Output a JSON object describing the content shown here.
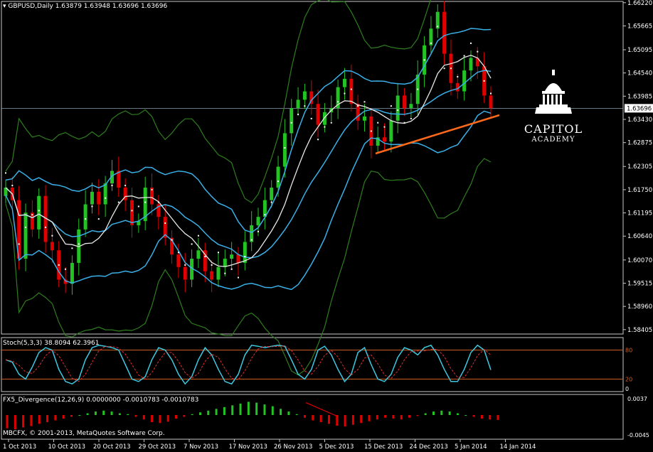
{
  "header": {
    "symbol": "GBPUSD,Daily",
    "ohlc": "1.63879 1.63948 1.63696 1.63696"
  },
  "price_label": "1.63696",
  "logo": {
    "line1": "CAPITOL",
    "line2": "ACADEMY"
  },
  "stoch": {
    "label": "Stoch(5,3,3) 38.8094 62.3961",
    "levels": [
      "80",
      "20"
    ]
  },
  "fx5": {
    "label": "FX5_Divergence(12,26,9) 0.0000000 -0.0010783 -0.0010783",
    "ticks": [
      "0.0037",
      "-0.0045"
    ]
  },
  "copyright": "MBCFX, © 2001-2013, MetaQuotes Software Corp.",
  "colors": {
    "bull": "#22c322",
    "bear": "#e00000",
    "band_outer": "#2e7d1e",
    "band_inner": "#3ab0e8",
    "ma": "#e8e8e8",
    "ma_down": "#ff6a4d",
    "trend": "#ff6a1a",
    "sar": "#ffffff",
    "stoch_main": "#3ec8e0",
    "stoch_signal": "#e03030",
    "level": "#d06020"
  },
  "chart_data": [
    {
      "type": "candlestick",
      "title": "GBPUSD,Daily",
      "ylim": [
        1.582,
        1.625
      ],
      "y_ticks": [
        "1.66220",
        "1.65665",
        "1.65095",
        "1.64540",
        "1.63985",
        "1.63430",
        "1.62875",
        "1.62305",
        "1.61750",
        "1.61195",
        "1.60640",
        "1.60070",
        "1.59515",
        "1.58960",
        "1.58405"
      ],
      "x_ticks": [
        "1 Oct 2013",
        "10 Oct 2013",
        "20 Oct 2013",
        "29 Oct 2013",
        "7 Nov 2013",
        "17 Nov 2013",
        "26 Nov 2013",
        "5 Dec 2013",
        "15 Dec 2013",
        "24 Dec 2013",
        "5 Jan 2014",
        "14 Jan 2014"
      ],
      "closes": [
        1.618,
        1.615,
        1.601,
        1.612,
        1.608,
        1.616,
        1.605,
        1.603,
        1.596,
        1.595,
        1.6,
        1.608,
        1.614,
        1.617,
        1.614,
        1.619,
        1.622,
        1.618,
        1.615,
        1.609,
        1.61,
        1.618,
        1.614,
        1.611,
        1.606,
        1.602,
        1.599,
        1.596,
        1.601,
        1.603,
        1.598,
        1.596,
        1.599,
        1.601,
        1.602,
        1.6,
        1.605,
        1.609,
        1.611,
        1.615,
        1.618,
        1.623,
        1.631,
        1.637,
        1.639,
        1.641,
        1.638,
        1.633,
        1.636,
        1.637,
        1.642,
        1.644,
        1.638,
        1.634,
        1.635,
        1.628,
        1.63,
        1.629,
        1.634,
        1.64,
        1.637,
        1.638,
        1.645,
        1.652,
        1.656,
        1.66,
        1.65,
        1.643,
        1.641,
        1.646,
        1.649,
        1.647,
        1.64,
        1.637
      ],
      "series": [
        {
          "name": "",
          "values": []
        }
      ]
    },
    {
      "type": "line",
      "title": "Stoch(5,3,3) 38.8094 62.3961",
      "ylim": [
        0,
        100
      ],
      "levels": [
        80,
        20
      ],
      "values": [
        60,
        55,
        30,
        20,
        45,
        75,
        85,
        80,
        40,
        15,
        10,
        20,
        60,
        85,
        90,
        88,
        85,
        80,
        50,
        20,
        15,
        25,
        60,
        85,
        80,
        60,
        30,
        10,
        25,
        60,
        85,
        70,
        40,
        15,
        10,
        30,
        70,
        90,
        88,
        85,
        88,
        90,
        88,
        60,
        30,
        20,
        40,
        80,
        88,
        70,
        40,
        15,
        30,
        75,
        85,
        50,
        20,
        15,
        30,
        65,
        85,
        80,
        70,
        85,
        90,
        70,
        40,
        15,
        15,
        40,
        75,
        90,
        80,
        39
      ]
    },
    {
      "type": "bar",
      "title": "FX5_Divergence(12,26,9) 0.0000000 -0.0010783 -0.0010783",
      "ylim": [
        -0.0045,
        0.0037
      ],
      "values": [
        -0.003,
        -0.0032,
        -0.0028,
        -0.0025,
        -0.002,
        -0.0016,
        -0.0012,
        -0.0008,
        -0.0004,
        0.0,
        0.0004,
        0.0008,
        0.001,
        0.0008,
        0.0004,
        0.0002,
        -0.0004,
        -0.001,
        -0.0016,
        -0.0018,
        -0.0015,
        -0.0008,
        -0.0004,
        0.0002,
        0.0006,
        0.001,
        0.0014,
        0.0018,
        0.0022,
        0.0026,
        0.003,
        0.0028,
        0.0024,
        0.002,
        0.0014,
        0.0008,
        0.0002,
        -0.0006,
        -0.0012,
        -0.0016,
        -0.002,
        -0.0024,
        -0.0026,
        -0.0022,
        -0.0018,
        -0.0014,
        -0.001,
        -0.0006,
        -0.0008,
        -0.001,
        -0.0006,
        -0.0002,
        0.0004,
        0.0008,
        0.001,
        0.0008,
        0.0004,
        0.0,
        -0.0004,
        -0.0008,
        -0.001,
        -0.0011
      ]
    }
  ]
}
